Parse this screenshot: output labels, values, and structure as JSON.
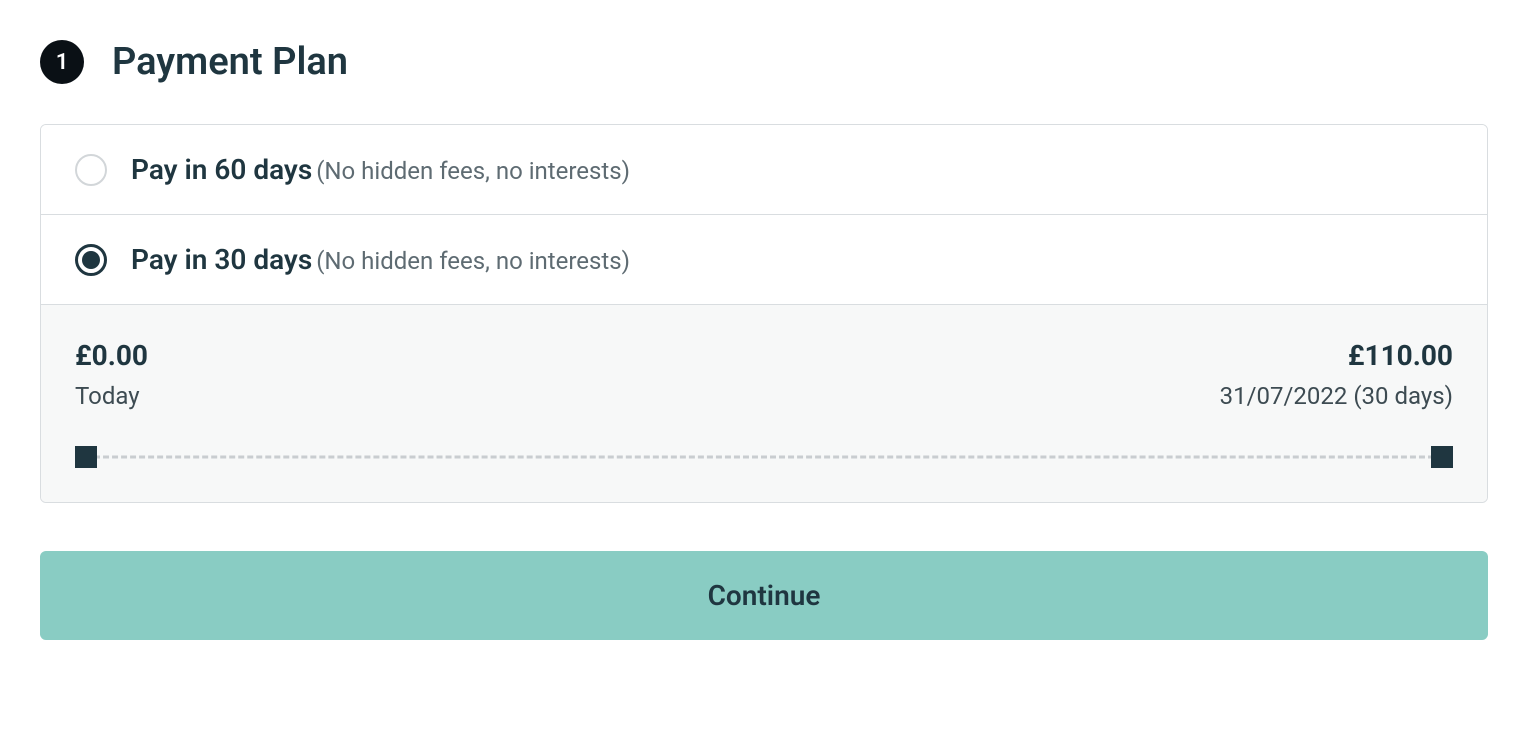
{
  "step": {
    "number": "1",
    "title": "Payment Plan"
  },
  "options": [
    {
      "label": "Pay in 60 days",
      "sub": "(No hidden fees, no interests)",
      "selected": false
    },
    {
      "label": "Pay in 30 days",
      "sub": "(No hidden fees, no interests)",
      "selected": true
    }
  ],
  "schedule": {
    "start": {
      "amount": "£0.00",
      "label": "Today"
    },
    "end": {
      "amount": "£110.00",
      "label": "31/07/2022 (30 days)"
    }
  },
  "continue_label": "Continue"
}
